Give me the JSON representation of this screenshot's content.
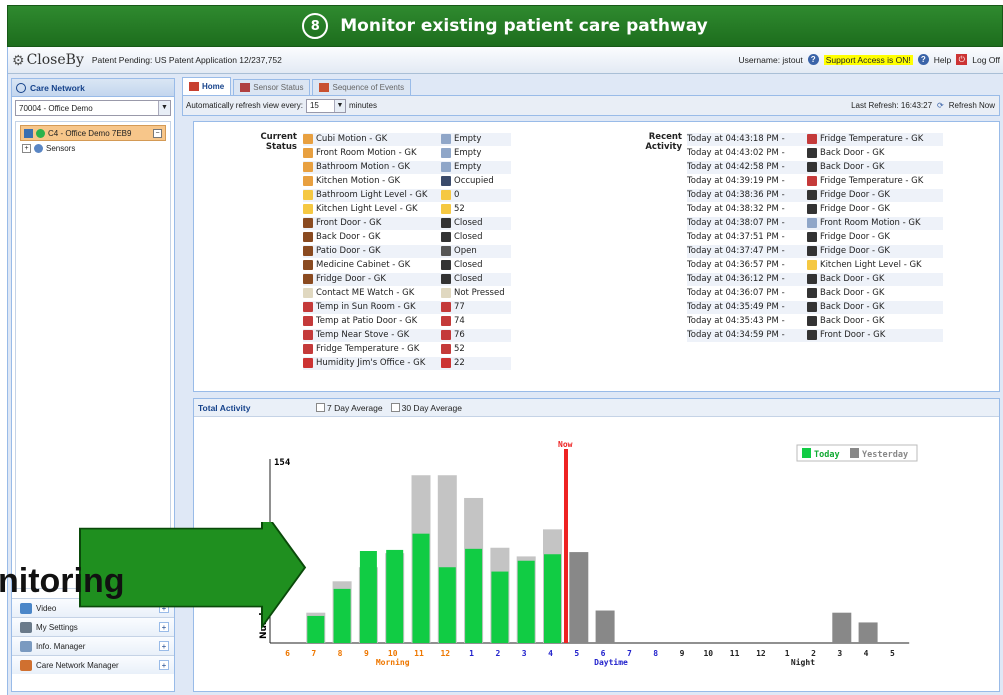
{
  "banner": {
    "title": "Monitor existing patient care pathway",
    "logo_letter": "8"
  },
  "topbar": {
    "brand": "CloseBy",
    "patent": "Patent Pending: US Patent Application 12/237,752",
    "username": "Username: jstout",
    "support": "Support Access is ON!",
    "help": "Help",
    "logoff": "Log Off"
  },
  "left": {
    "title": "Care Network",
    "site_value": "70004 - Office Demo",
    "tree_selected": "C4 - Office Demo 7EB9",
    "tree_child": "Sensors",
    "bottom_items": [
      {
        "label": "Video",
        "icon": "video-icon"
      },
      {
        "label": "My Settings",
        "icon": "settings-icon"
      },
      {
        "label": "Info. Manager",
        "icon": "info-manager-icon"
      },
      {
        "label": "Care Network Manager",
        "icon": "network-manager-icon"
      }
    ]
  },
  "tabs": [
    {
      "label": "Home",
      "active": true
    },
    {
      "label": "Sensor Status",
      "active": false
    },
    {
      "label": "Sequence of Events",
      "active": false
    }
  ],
  "toolbar": {
    "refresh_prefix": "Automatically refresh view every:",
    "refresh_value": "15",
    "refresh_suffix": "minutes",
    "last_refresh": "Last Refresh: 16:43:27",
    "refresh_now": "Refresh Now"
  },
  "status": {
    "current_title_1": "Current",
    "current_title_2": "Status",
    "items": [
      {
        "name": "Cubi Motion - GK",
        "value": "Empty",
        "icon": "motion-icon",
        "value_icon": "sensor-empty-icon"
      },
      {
        "name": "Front Room Motion - GK",
        "value": "Empty",
        "icon": "motion-icon",
        "value_icon": "sensor-empty-icon"
      },
      {
        "name": "Bathroom Motion - GK",
        "value": "Empty",
        "icon": "motion-icon",
        "value_icon": "sensor-empty-icon"
      },
      {
        "name": "Kitchen Motion - GK",
        "value": "Occupied",
        "icon": "motion-icon",
        "value_icon": "sensor-occupied-icon"
      },
      {
        "name": "Bathroom Light Level - GK",
        "value": "0",
        "icon": "light-icon",
        "value_icon": "light-icon"
      },
      {
        "name": "Kitchen Light Level - GK",
        "value": "52",
        "icon": "light-icon",
        "value_icon": "light-icon"
      },
      {
        "name": "Front Door - GK",
        "value": "Closed",
        "icon": "door-icon",
        "value_icon": "door-closed-icon"
      },
      {
        "name": "Back Door - GK",
        "value": "Closed",
        "icon": "door-icon",
        "value_icon": "door-closed-icon"
      },
      {
        "name": "Patio Door - GK",
        "value": "Open",
        "icon": "door-icon",
        "value_icon": "door-open-icon"
      },
      {
        "name": "Medicine Cabinet - GK",
        "value": "Closed",
        "icon": "door-icon",
        "value_icon": "door-closed-icon"
      },
      {
        "name": "Fridge Door - GK",
        "value": "Closed",
        "icon": "door-icon",
        "value_icon": "door-closed-icon"
      },
      {
        "name": "Contact ME Watch - GK",
        "value": "Not Pressed",
        "icon": "watch-icon",
        "value_icon": "watch-icon"
      },
      {
        "name": "Temp in Sun Room - GK",
        "value": "77",
        "icon": "thermometer-icon",
        "value_icon": "thermometer-icon"
      },
      {
        "name": "Temp at Patio Door - GK",
        "value": "74",
        "icon": "thermometer-icon",
        "value_icon": "thermometer-icon"
      },
      {
        "name": "Temp Near Stove - GK",
        "value": "76",
        "icon": "thermometer-icon",
        "value_icon": "thermometer-icon"
      },
      {
        "name": "Fridge Temperature - GK",
        "value": "52",
        "icon": "thermometer-icon",
        "value_icon": "thermometer-icon"
      },
      {
        "name": "Humidity Jim's Office - GK",
        "value": "22",
        "icon": "humidity-icon",
        "value_icon": "humidity-icon"
      }
    ],
    "recent_title_1": "Recent",
    "recent_title_2": "Activity",
    "recent": [
      {
        "time": "Today at 04:43:18 PM -",
        "sensor": "Fridge Temperature - GK",
        "icon": "thermometer-icon"
      },
      {
        "time": "Today at 04:43:02 PM -",
        "sensor": "Back Door - GK",
        "icon": "door-closed-icon"
      },
      {
        "time": "Today at 04:42:58 PM -",
        "sensor": "Back Door - GK",
        "icon": "door-closed-icon"
      },
      {
        "time": "Today at 04:39:19 PM -",
        "sensor": "Fridge Temperature - GK",
        "icon": "thermometer-icon"
      },
      {
        "time": "Today at 04:38:36 PM -",
        "sensor": "Fridge Door - GK",
        "icon": "door-closed-icon"
      },
      {
        "time": "Today at 04:38:32 PM -",
        "sensor": "Fridge Door - GK",
        "icon": "door-closed-icon"
      },
      {
        "time": "Today at 04:38:07 PM -",
        "sensor": "Front Room Motion - GK",
        "icon": "sensor-empty-icon"
      },
      {
        "time": "Today at 04:37:51 PM -",
        "sensor": "Fridge Door - GK",
        "icon": "door-closed-icon"
      },
      {
        "time": "Today at 04:37:47 PM -",
        "sensor": "Fridge Door - GK",
        "icon": "door-closed-icon"
      },
      {
        "time": "Today at 04:36:57 PM -",
        "sensor": "Kitchen Light Level - GK",
        "icon": "light-icon"
      },
      {
        "time": "Today at 04:36:12 PM -",
        "sensor": "Back Door - GK",
        "icon": "door-closed-icon"
      },
      {
        "time": "Today at 04:36:07 PM -",
        "sensor": "Back Door - GK",
        "icon": "door-closed-icon"
      },
      {
        "time": "Today at 04:35:49 PM -",
        "sensor": "Back Door - GK",
        "icon": "door-closed-icon"
      },
      {
        "time": "Today at 04:35:43 PM -",
        "sensor": "Back Door - GK",
        "icon": "door-closed-icon"
      },
      {
        "time": "Today at 04:34:59 PM -",
        "sensor": "Front Door - GK",
        "icon": "door-closed-icon"
      }
    ]
  },
  "activity": {
    "title": "Total Activity",
    "opt7": "7 Day Average",
    "opt30": "30 Day Average"
  },
  "overlay": {
    "text": "nitoring"
  },
  "colors": {
    "banner": "#1d6d1d",
    "today": "#11cc44",
    "yesterday": "#c4c4c4",
    "now": "#ee2222",
    "arrow": "#1f8f1f"
  },
  "chart_data": {
    "type": "bar",
    "ylabel": "Number",
    "ytick": 154,
    "now_label": "Now",
    "legend": [
      "Today",
      "Yesterday"
    ],
    "periods": [
      "Morning",
      "Daytime",
      "Night"
    ],
    "categories": [
      "6",
      "7",
      "8",
      "9",
      "10",
      "11",
      "12",
      "1",
      "2",
      "3",
      "4",
      "5",
      "6",
      "7",
      "8",
      "9",
      "10",
      "11",
      "12",
      "1",
      "2",
      "3",
      "4",
      "5"
    ],
    "category_colors": [
      "#ee7700",
      "#ee7700",
      "#ee7700",
      "#ee7700",
      "#ee7700",
      "#ee7700",
      "#ee7700",
      "#2222cc",
      "#2222cc",
      "#2222cc",
      "#2222cc",
      "#2222cc",
      "#2222cc",
      "#2222cc",
      "#2222cc",
      "#222222",
      "#222222",
      "#222222",
      "#222222",
      "#222222",
      "#222222",
      "#222222",
      "#222222",
      "#222222"
    ],
    "series": [
      {
        "name": "Today",
        "values": [
          0,
          25,
          50,
          85,
          86,
          101,
          70,
          87,
          66,
          76,
          82,
          0,
          0,
          0,
          0,
          0,
          0,
          0,
          0,
          0,
          0,
          0,
          0,
          0
        ]
      },
      {
        "name": "Yesterday",
        "values": [
          0,
          28,
          57,
          70,
          83,
          155,
          155,
          134,
          88,
          80,
          105,
          84,
          30,
          0,
          0,
          0,
          0,
          0,
          0,
          0,
          0,
          28,
          19,
          0
        ]
      }
    ],
    "ylim": [
      0,
      170
    ]
  }
}
